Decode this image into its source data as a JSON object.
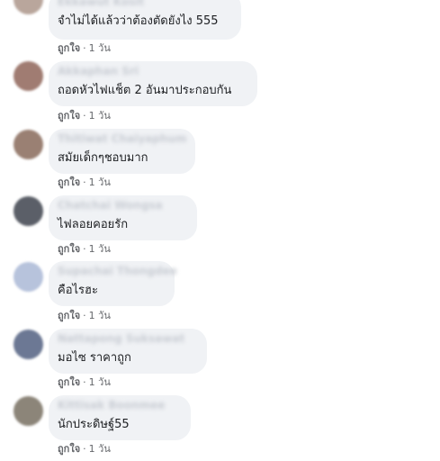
{
  "comments": [
    {
      "name": "Ekkawut Kosit",
      "text": "จำไม่ได้แล้วว่าต้องตัดยังไง 555",
      "like_label": "ถูกใจ",
      "time": "1 วัน",
      "avatar_color": "#b9a69c"
    },
    {
      "name": "Akkaphan Sri",
      "text": "ถอดหัวไฟแช็ต 2 อันมาประกอบกัน",
      "like_label": "ถูกใจ",
      "time": "1 วัน",
      "avatar_color": "#a07c72"
    },
    {
      "name": "Thitiwat Chaiyaphum",
      "text": "สมัยเด็กๆชอบมาก",
      "like_label": "ถูกใจ",
      "time": "1 วัน",
      "avatar_color": "#9a8073"
    },
    {
      "name": "Chatchai Wongsa",
      "text": "ไฟลอยคอยรัก",
      "like_label": "ถูกใจ",
      "time": "1 วัน",
      "avatar_color": "#5b5f68"
    },
    {
      "name": "Supachai Thongdee",
      "text": "คือไรฮะ",
      "like_label": "ถูกใจ",
      "time": "1 วัน",
      "avatar_color": "#b7c3dc"
    },
    {
      "name": "Nattapong Suksawat",
      "text": "มอไซ ราคาถูก",
      "like_label": "ถูกใจ",
      "time": "1 วัน",
      "avatar_color": "#6c7894"
    },
    {
      "name": "Kittisak Boonmee",
      "text": "นักประดิษฐ์55",
      "like_label": "ถูกใจ",
      "time": "1 วัน",
      "avatar_color": "#8c8579"
    }
  ],
  "separator": "·"
}
